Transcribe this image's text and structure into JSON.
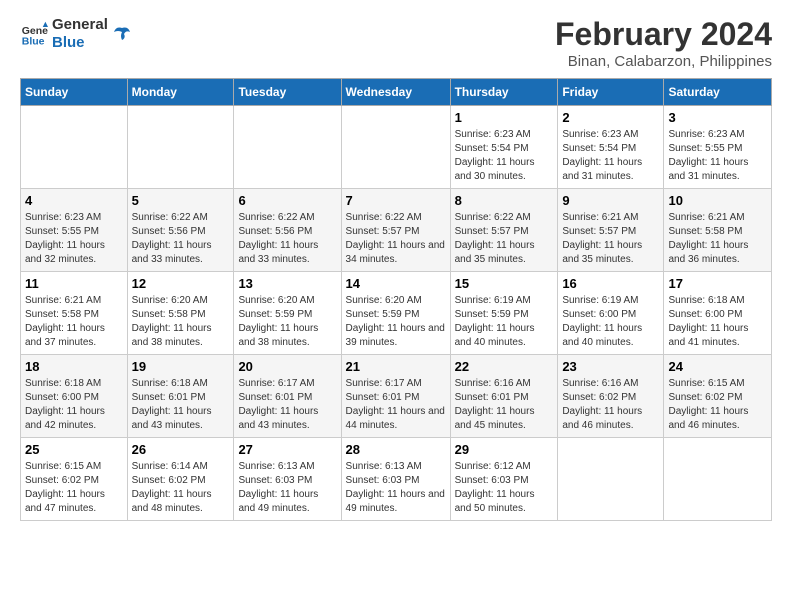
{
  "header": {
    "logo_line1": "General",
    "logo_line2": "Blue",
    "title": "February 2024",
    "subtitle": "Binan, Calabarzon, Philippines"
  },
  "columns": [
    "Sunday",
    "Monday",
    "Tuesday",
    "Wednesday",
    "Thursday",
    "Friday",
    "Saturday"
  ],
  "weeks": [
    [
      {
        "day": "",
        "info": ""
      },
      {
        "day": "",
        "info": ""
      },
      {
        "day": "",
        "info": ""
      },
      {
        "day": "",
        "info": ""
      },
      {
        "day": "1",
        "info": "Sunrise: 6:23 AM\nSunset: 5:54 PM\nDaylight: 11 hours and 30 minutes."
      },
      {
        "day": "2",
        "info": "Sunrise: 6:23 AM\nSunset: 5:54 PM\nDaylight: 11 hours and 31 minutes."
      },
      {
        "day": "3",
        "info": "Sunrise: 6:23 AM\nSunset: 5:55 PM\nDaylight: 11 hours and 31 minutes."
      }
    ],
    [
      {
        "day": "4",
        "info": "Sunrise: 6:23 AM\nSunset: 5:55 PM\nDaylight: 11 hours and 32 minutes."
      },
      {
        "day": "5",
        "info": "Sunrise: 6:22 AM\nSunset: 5:56 PM\nDaylight: 11 hours and 33 minutes."
      },
      {
        "day": "6",
        "info": "Sunrise: 6:22 AM\nSunset: 5:56 PM\nDaylight: 11 hours and 33 minutes."
      },
      {
        "day": "7",
        "info": "Sunrise: 6:22 AM\nSunset: 5:57 PM\nDaylight: 11 hours and 34 minutes."
      },
      {
        "day": "8",
        "info": "Sunrise: 6:22 AM\nSunset: 5:57 PM\nDaylight: 11 hours and 35 minutes."
      },
      {
        "day": "9",
        "info": "Sunrise: 6:21 AM\nSunset: 5:57 PM\nDaylight: 11 hours and 35 minutes."
      },
      {
        "day": "10",
        "info": "Sunrise: 6:21 AM\nSunset: 5:58 PM\nDaylight: 11 hours and 36 minutes."
      }
    ],
    [
      {
        "day": "11",
        "info": "Sunrise: 6:21 AM\nSunset: 5:58 PM\nDaylight: 11 hours and 37 minutes."
      },
      {
        "day": "12",
        "info": "Sunrise: 6:20 AM\nSunset: 5:58 PM\nDaylight: 11 hours and 38 minutes."
      },
      {
        "day": "13",
        "info": "Sunrise: 6:20 AM\nSunset: 5:59 PM\nDaylight: 11 hours and 38 minutes."
      },
      {
        "day": "14",
        "info": "Sunrise: 6:20 AM\nSunset: 5:59 PM\nDaylight: 11 hours and 39 minutes."
      },
      {
        "day": "15",
        "info": "Sunrise: 6:19 AM\nSunset: 5:59 PM\nDaylight: 11 hours and 40 minutes."
      },
      {
        "day": "16",
        "info": "Sunrise: 6:19 AM\nSunset: 6:00 PM\nDaylight: 11 hours and 40 minutes."
      },
      {
        "day": "17",
        "info": "Sunrise: 6:18 AM\nSunset: 6:00 PM\nDaylight: 11 hours and 41 minutes."
      }
    ],
    [
      {
        "day": "18",
        "info": "Sunrise: 6:18 AM\nSunset: 6:00 PM\nDaylight: 11 hours and 42 minutes."
      },
      {
        "day": "19",
        "info": "Sunrise: 6:18 AM\nSunset: 6:01 PM\nDaylight: 11 hours and 43 minutes."
      },
      {
        "day": "20",
        "info": "Sunrise: 6:17 AM\nSunset: 6:01 PM\nDaylight: 11 hours and 43 minutes."
      },
      {
        "day": "21",
        "info": "Sunrise: 6:17 AM\nSunset: 6:01 PM\nDaylight: 11 hours and 44 minutes."
      },
      {
        "day": "22",
        "info": "Sunrise: 6:16 AM\nSunset: 6:01 PM\nDaylight: 11 hours and 45 minutes."
      },
      {
        "day": "23",
        "info": "Sunrise: 6:16 AM\nSunset: 6:02 PM\nDaylight: 11 hours and 46 minutes."
      },
      {
        "day": "24",
        "info": "Sunrise: 6:15 AM\nSunset: 6:02 PM\nDaylight: 11 hours and 46 minutes."
      }
    ],
    [
      {
        "day": "25",
        "info": "Sunrise: 6:15 AM\nSunset: 6:02 PM\nDaylight: 11 hours and 47 minutes."
      },
      {
        "day": "26",
        "info": "Sunrise: 6:14 AM\nSunset: 6:02 PM\nDaylight: 11 hours and 48 minutes."
      },
      {
        "day": "27",
        "info": "Sunrise: 6:13 AM\nSunset: 6:03 PM\nDaylight: 11 hours and 49 minutes."
      },
      {
        "day": "28",
        "info": "Sunrise: 6:13 AM\nSunset: 6:03 PM\nDaylight: 11 hours and 49 minutes."
      },
      {
        "day": "29",
        "info": "Sunrise: 6:12 AM\nSunset: 6:03 PM\nDaylight: 11 hours and 50 minutes."
      },
      {
        "day": "",
        "info": ""
      },
      {
        "day": "",
        "info": ""
      }
    ]
  ]
}
